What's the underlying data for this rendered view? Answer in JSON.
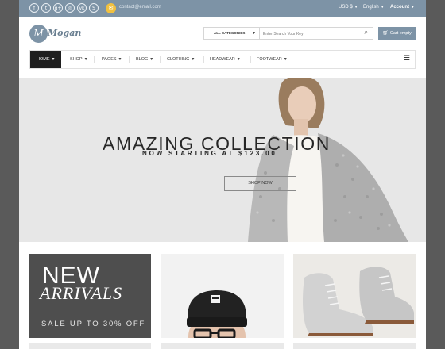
{
  "topbar": {
    "social_icons": [
      "facebook-icon",
      "twitter-icon",
      "google-plus-icon",
      "dribbble-icon",
      "vk-icon",
      "skype-icon"
    ],
    "social_glyphs": [
      "f",
      "t",
      "g+",
      "◎",
      "vk",
      "S"
    ],
    "email": "contact@email.com",
    "currency": "USD $",
    "language": "English",
    "account": "Account",
    "accent_color": "#7d93a6"
  },
  "header": {
    "logo_initial": "M",
    "logo_text": "Mogan",
    "search": {
      "category_label": "ALL CATEGORIES",
      "placeholder": "Enter Search Your Key"
    },
    "cart_label": "Cart empty"
  },
  "nav": {
    "items": [
      {
        "label": "HOME"
      },
      {
        "label": "SHOP"
      },
      {
        "label": "PAGES"
      },
      {
        "label": "BLOG"
      },
      {
        "label": "CLOTHING"
      },
      {
        "label": "HEADWEAR"
      },
      {
        "label": "FOOTWEAR"
      }
    ]
  },
  "hero": {
    "title": "AMAZING COLLECTION",
    "subtitle": "NOW STARTING AT $123.00",
    "button_label": "SHOP NOW"
  },
  "banners": {
    "new_arrivals": {
      "line1": "NEW",
      "line2": "ARRIVALS",
      "sale": "SALE UP TO 30% OFF"
    }
  }
}
